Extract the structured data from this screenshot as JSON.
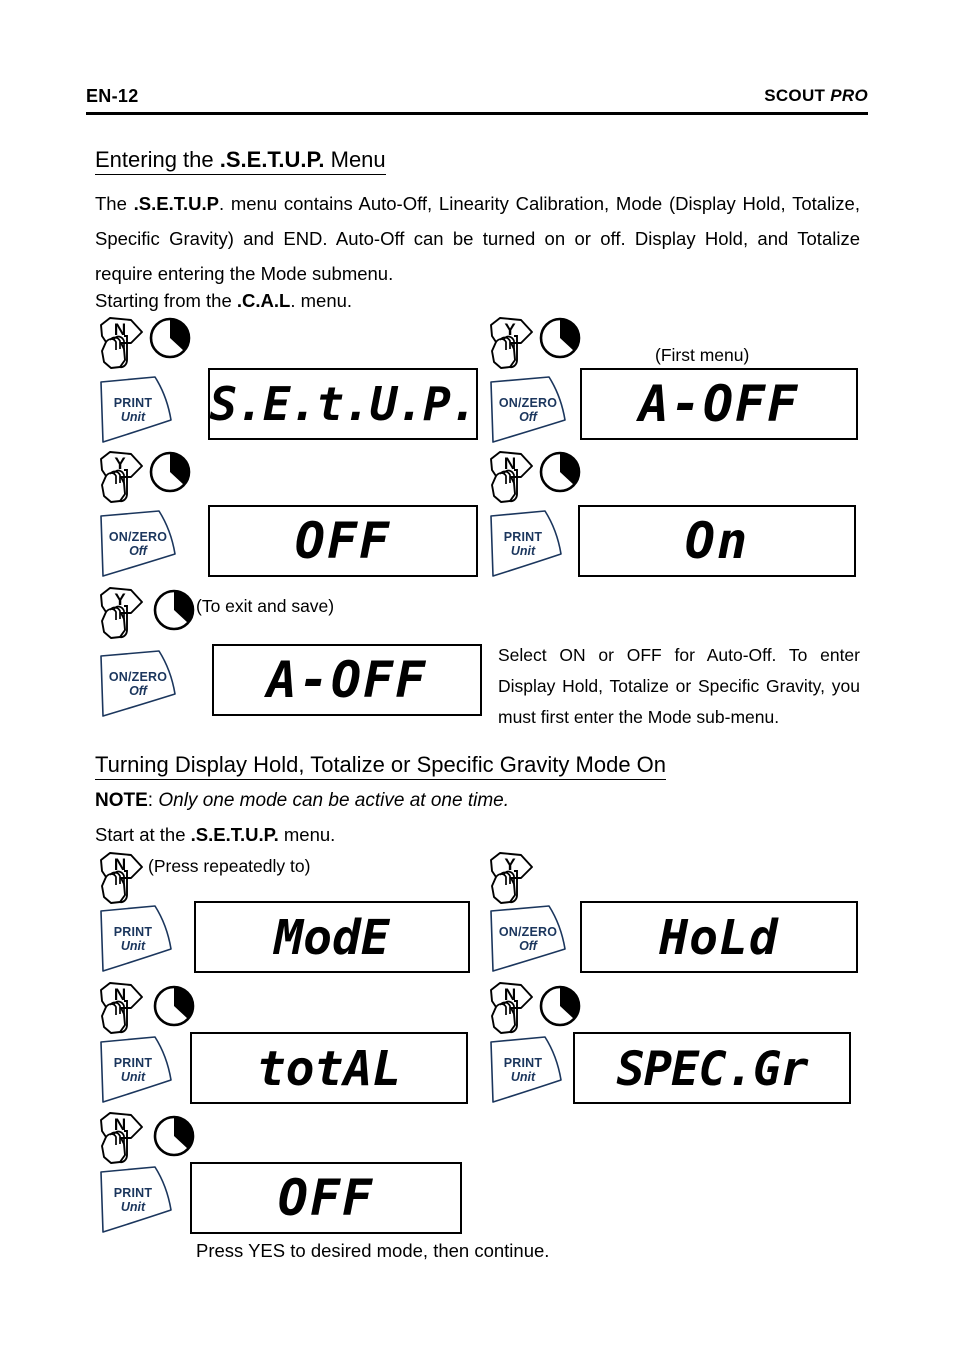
{
  "header": {
    "page_number": "EN-12",
    "brand": "SCOUT",
    "brand_italic": "PRO"
  },
  "section1": {
    "heading_pre": "Entering the ",
    "heading_bold": ".S.E.T.U.P.",
    "heading_post": " Menu",
    "paragraph_1_a": "The ",
    "paragraph_1_b": ".S.E.T.U.P",
    "paragraph_1_c": ". menu contains Auto-Off, Linearity Calibration, Mode (Display Hold, Totalize, Specific Gravity) and END.  Auto-Off can be turned on or off.  Display Hold, and Totalize require entering the Mode submenu.",
    "start_line_a": "Starting from the ",
    "start_line_b": ".C.A.L",
    "start_line_c": ". menu.",
    "first_menu_caption": "(First menu)",
    "exit_caption": "(To exit and save)",
    "side_note": "Select ON or OFF for Auto-Off.   To enter Display Hold, Totalize or Specific Gravity, you must first enter the Mode sub-menu."
  },
  "section2": {
    "heading": "Turning Display Hold, Totalize or Specific Gravity Mode On",
    "note_label": "NOTE",
    "note_colon": ":  ",
    "note_text": "Only one mode can be active at one time.",
    "start_line_a": "Start at the ",
    "start_line_b": ".S.E.T.U.P.",
    "start_line_c": " menu.",
    "press_repeatedly_caption": "(Press repeatedly to)",
    "footer_note": "Press YES to desired mode, then continue."
  },
  "keys": {
    "print": {
      "line1": "PRINT",
      "line2": "Unit"
    },
    "onzero": {
      "line1": "ON/ZERO",
      "line2": "Off"
    }
  },
  "answers": {
    "no": "N",
    "yes": "Y"
  },
  "displays": {
    "setup": "S.E.t.U.P.",
    "a_off": "A-OFF",
    "off": "OFF",
    "on": "On",
    "a_off_2": "A-OFF",
    "mode": "ModE",
    "hold": "HoLd",
    "total": "totAL",
    "spec_gr": "SPEC.Gr",
    "off_2": "OFF"
  },
  "colors": {
    "ink": "#000000",
    "key_label": "#1b365d",
    "paper": "#ffffff"
  }
}
